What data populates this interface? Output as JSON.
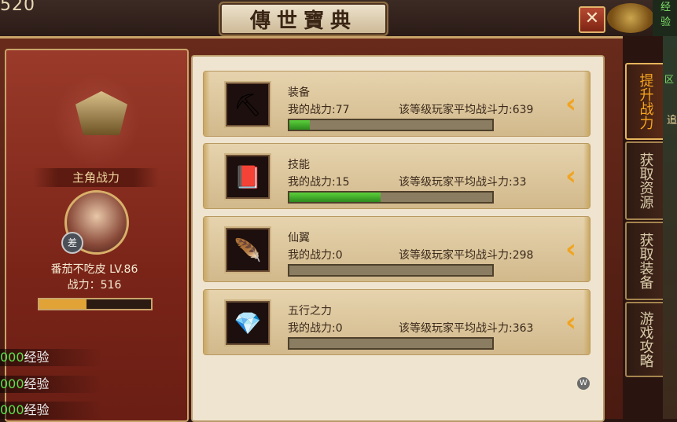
{
  "header": {
    "top_number": "520",
    "title": "傳世寶典",
    "close_label": "✕",
    "corner_text": "经验"
  },
  "character": {
    "section_title": "主角战力",
    "rank_badge": "差",
    "name_level": "番茄不吃皮  LV.86",
    "power": "战力：516",
    "power_bar_fraction": 0.42
  },
  "exp_strips": [
    {
      "num": "000",
      "label": "经验"
    },
    {
      "num": "000",
      "label": "经验"
    },
    {
      "num": "000",
      "label": "经验"
    }
  ],
  "items": [
    {
      "name": "装备",
      "icon": "pickaxe-icon",
      "glyph": "⛏",
      "mine": "我的战力:77",
      "avg": "该等级玩家平均战斗力:639",
      "fraction": 0.1
    },
    {
      "name": "技能",
      "icon": "book-icon",
      "glyph": "📕",
      "mine": "我的战力:15",
      "avg": "该等级玩家平均战斗力:33",
      "fraction": 0.45
    },
    {
      "name": "仙翼",
      "icon": "feather-icon",
      "glyph": "🪶",
      "mine": "我的战力:0",
      "avg": "该等级玩家平均战斗力:298",
      "fraction": 0
    },
    {
      "name": "五行之力",
      "icon": "crystal-icon",
      "glyph": "💎",
      "mine": "我的战力:0",
      "avg": "该等级玩家平均战斗力:363",
      "fraction": 0
    }
  ],
  "tabs": [
    {
      "label": "提升战力",
      "active": true
    },
    {
      "label": "获取资源",
      "active": false
    },
    {
      "label": "获取装备",
      "active": false
    },
    {
      "label": "游戏攻略",
      "active": false
    }
  ],
  "right_edge": {
    "label1": "区",
    "label2": "追"
  },
  "watermark": "W",
  "colors": {
    "accent": "#f5a41e",
    "progress": "#3fb52a",
    "panel_bg": "#efe4cf"
  }
}
